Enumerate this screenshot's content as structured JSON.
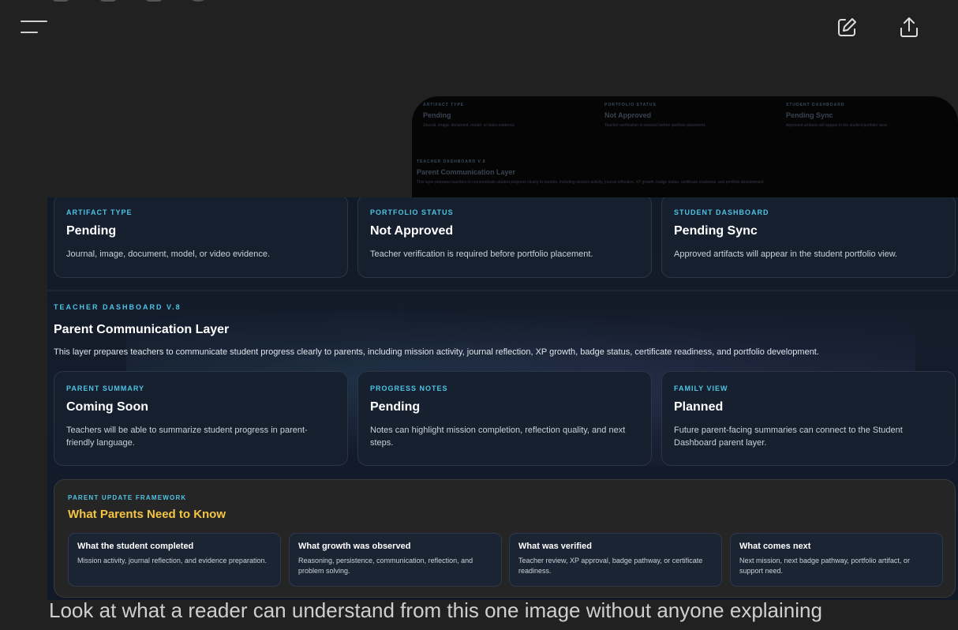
{
  "toolbar": {
    "menu_icon": "hamburger-menu-icon",
    "compose_icon": "compose-icon",
    "share_icon": "share-upload-icon"
  },
  "row1": [
    {
      "kicker": "ARTIFACT TYPE",
      "title": "Pending",
      "desc": "Journal, image, document, model, or video evidence."
    },
    {
      "kicker": "PORTFOLIO STATUS",
      "title": "Not Approved",
      "desc": "Teacher verification is required before portfolio placement."
    },
    {
      "kicker": "STUDENT DASHBOARD",
      "title": "Pending Sync",
      "desc": "Approved artifacts will appear in the student portfolio view."
    }
  ],
  "section": {
    "kicker": "TEACHER DASHBOARD V.8",
    "title": "Parent Communication Layer",
    "desc": "This layer prepares teachers to communicate student progress clearly to parents, including mission activity, journal reflection, XP growth, badge status, certificate readiness, and portfolio development."
  },
  "row2": [
    {
      "kicker": "PARENT SUMMARY",
      "title": "Coming Soon",
      "desc": "Teachers will be able to summarize student progress in parent-friendly language."
    },
    {
      "kicker": "PROGRESS NOTES",
      "title": "Pending",
      "desc": "Notes can highlight mission completion, reflection quality, and next steps."
    },
    {
      "kicker": "FAMILY VIEW",
      "title": "Planned",
      "desc": "Future parent-facing summaries can connect to the Student Dashboard parent layer."
    }
  ],
  "framework": {
    "kicker": "PARENT UPDATE FRAMEWORK",
    "title": "What Parents Need to Know",
    "items": [
      {
        "title": "What the student completed",
        "desc": "Mission activity, journal reflection, and evidence preparation."
      },
      {
        "title": "What growth was observed",
        "desc": "Reasoning, persistence, communication, reflection, and problem solving."
      },
      {
        "title": "What was verified",
        "desc": "Teacher review, XP approval, badge pathway, or certificate readiness."
      },
      {
        "title": "What comes next",
        "desc": "Next mission, next badge pathway, portfolio artifact, or support need."
      }
    ]
  },
  "caption": "Look at what a reader can understand from this one image without anyone explaining",
  "colors": {
    "accent": "#4fc3e6",
    "highlight": "#f4c542",
    "background": "#212121"
  }
}
